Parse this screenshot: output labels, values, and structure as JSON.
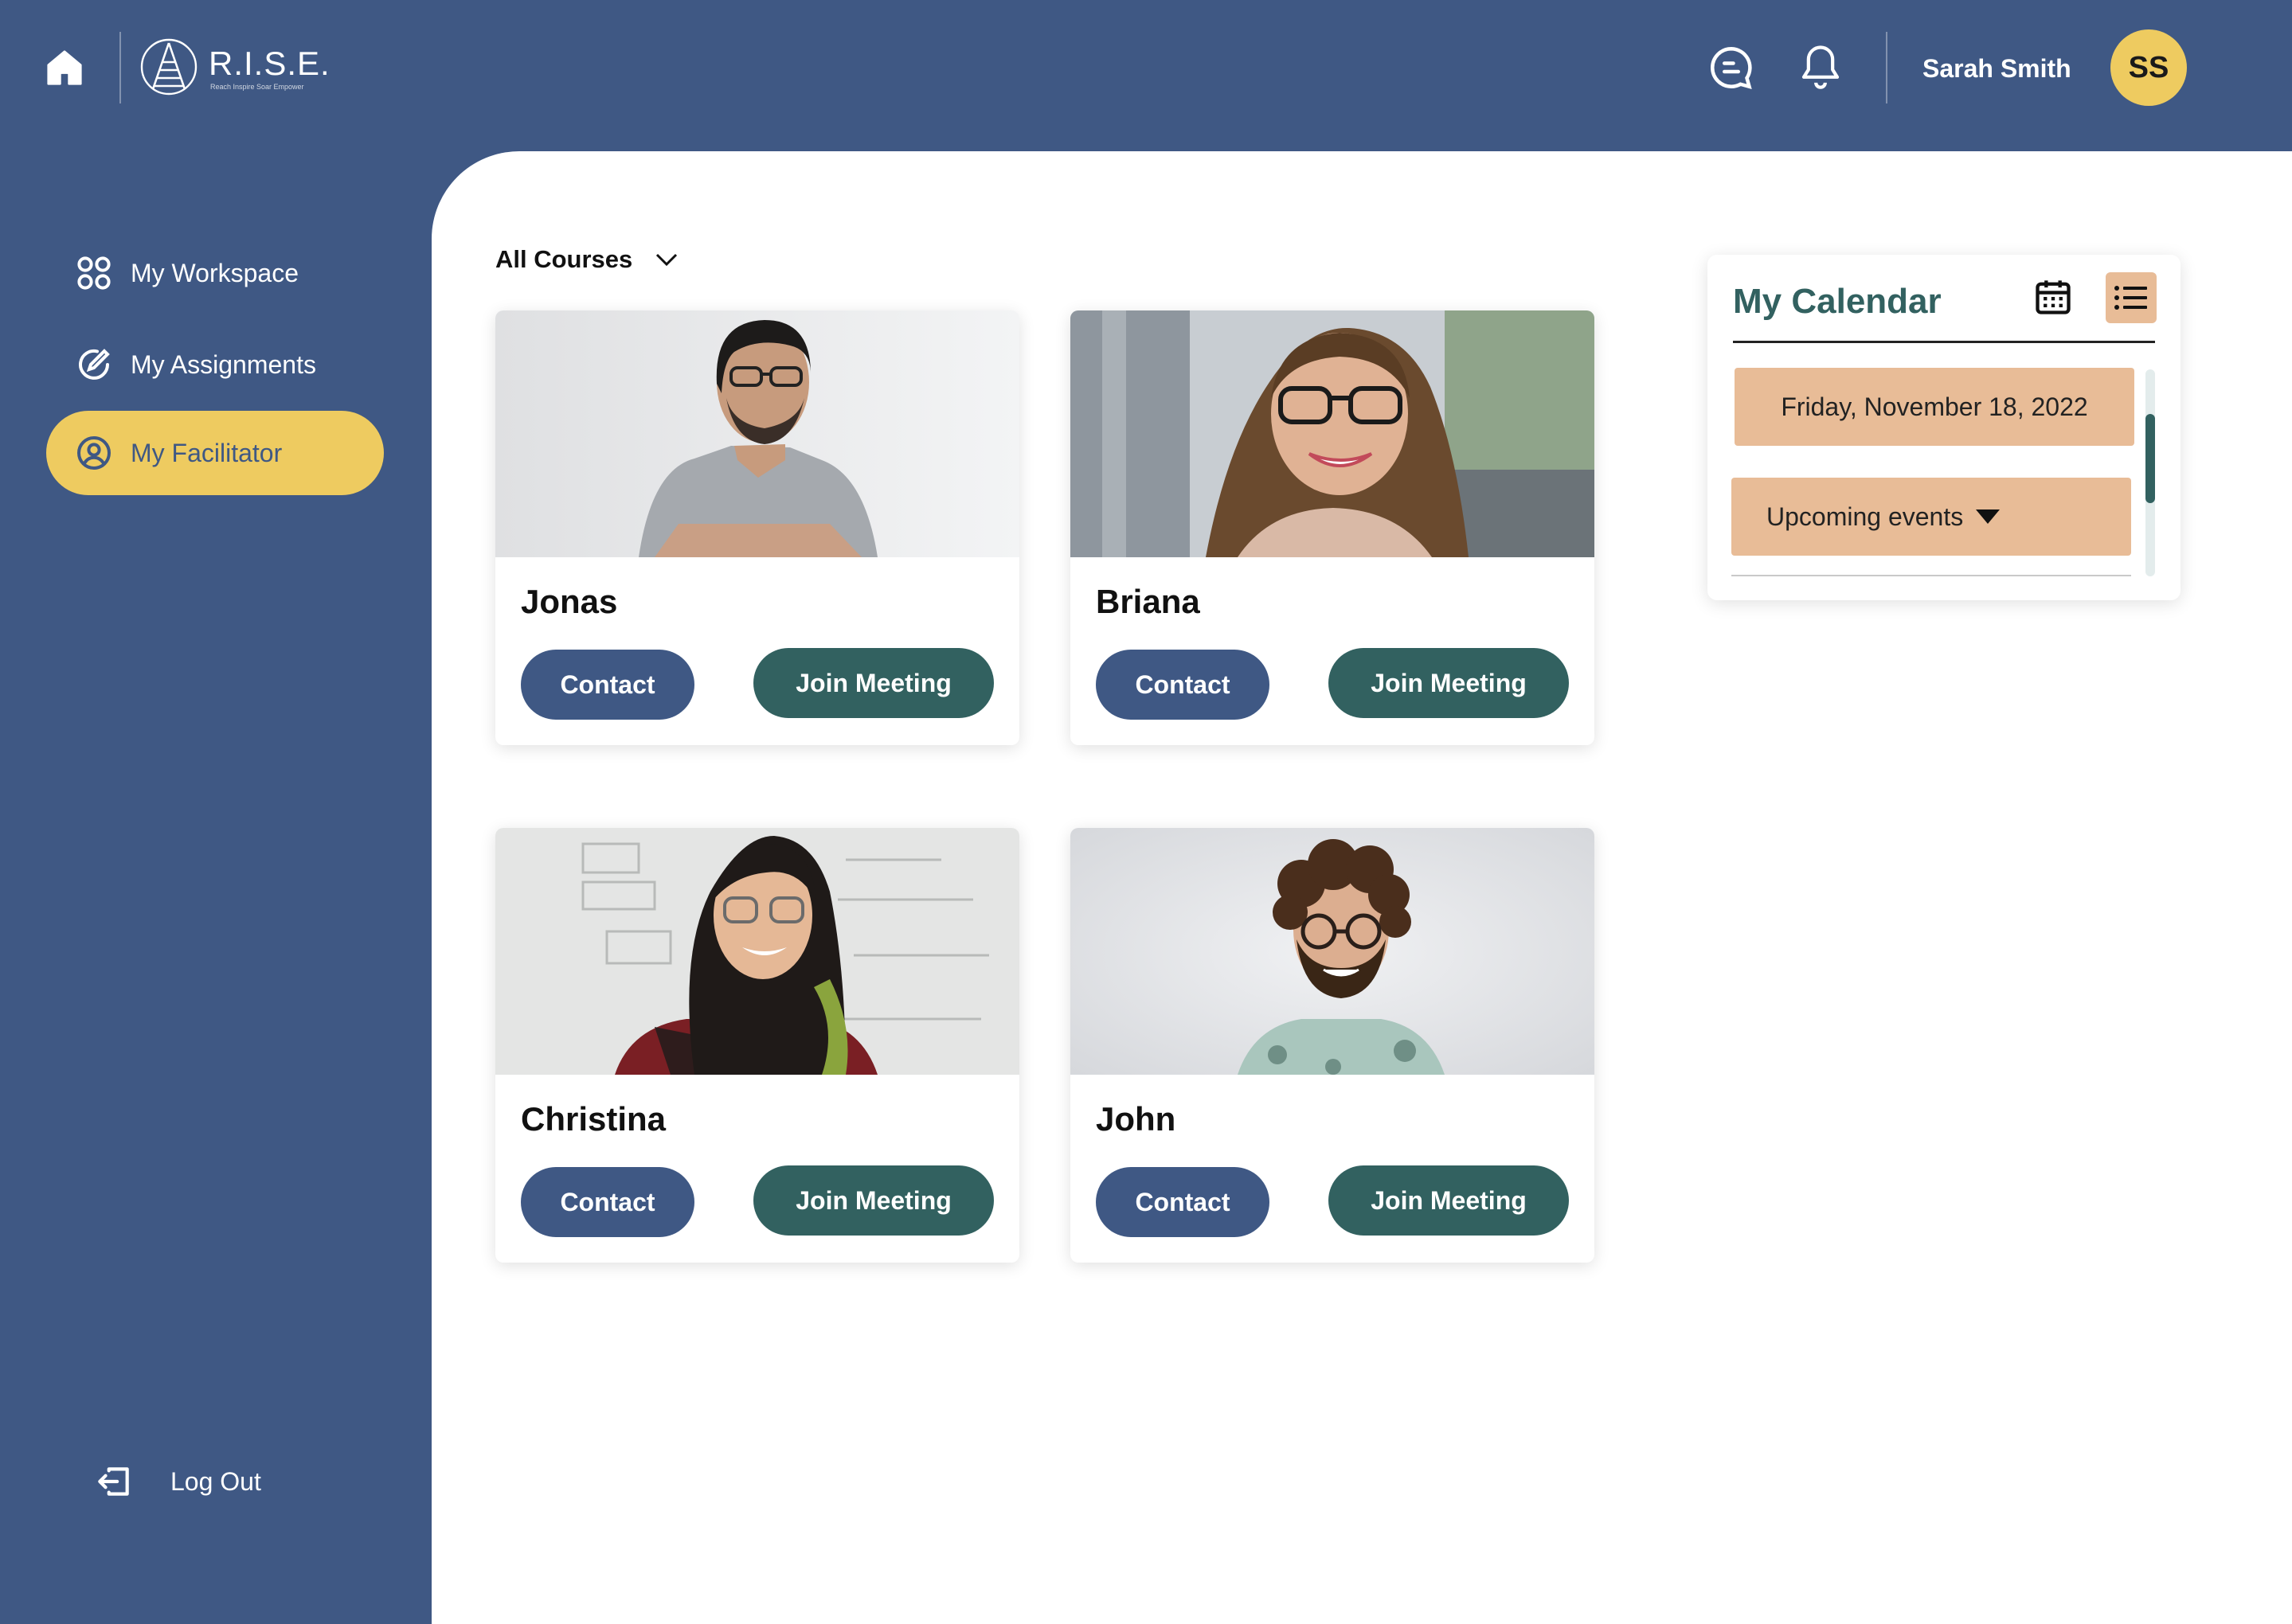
{
  "header": {
    "brand": "R.I.S.E.",
    "brand_tagline": "Reach Inspire Soar Empower",
    "user_name": "Sarah Smith",
    "user_initials": "SS"
  },
  "sidebar": {
    "items": [
      {
        "label": "My Workspace",
        "icon": "grid-icon",
        "active": false
      },
      {
        "label": "My Assignments",
        "icon": "assignment-check-icon",
        "active": false
      },
      {
        "label": "My Facilitator",
        "icon": "user-circle-icon",
        "active": true
      }
    ],
    "logout_label": "Log Out"
  },
  "main": {
    "course_filter": "All Courses",
    "facilitators": [
      {
        "name": "Jonas",
        "contact_label": "Contact",
        "join_label": "Join Meeting"
      },
      {
        "name": "Briana",
        "contact_label": "Contact",
        "join_label": "Join Meeting"
      },
      {
        "name": "Christina",
        "contact_label": "Contact",
        "join_label": "Join Meeting"
      },
      {
        "name": "John",
        "contact_label": "Contact",
        "join_label": "Join Meeting"
      }
    ]
  },
  "calendar": {
    "title": "My Calendar",
    "date": "Friday, November 18, 2022",
    "upcoming_label": "Upcoming events"
  },
  "colors": {
    "primary_blue": "#3F5884",
    "accent_yellow": "#EECB60",
    "teal": "#326160",
    "peach": "#E8BC97"
  }
}
